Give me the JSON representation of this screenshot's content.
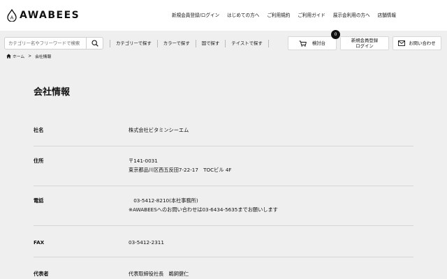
{
  "header": {
    "logo_text": "AWABEES",
    "nav": [
      "新規会員登録/ログイン",
      "はじめての方へ",
      "ご利用規約",
      "ご利用ガイド",
      "展示会利用の方へ",
      "店舗情報"
    ]
  },
  "search": {
    "placeholder": "カテゴリー名やフリーワードで検索"
  },
  "filters": [
    "カテゴリーで探す",
    "カラーで探す",
    "国で探す",
    "テイストで探す"
  ],
  "actions": {
    "cart_label": "検討台",
    "cart_count": "0",
    "register_label_line1": "新規会員登録",
    "register_label_line2": "ログイン",
    "contact_label": "お問い合わせ"
  },
  "breadcrumb": {
    "home": "ホーム",
    "separator": ">",
    "current": "会社情報"
  },
  "page": {
    "title": "会社情報",
    "rows": [
      {
        "label": "社名",
        "lines": [
          "株式会社ビタミンシーエム"
        ]
      },
      {
        "label": "住所",
        "lines": [
          "〒141-0031",
          "東京都品川区西五反田7-22-17　TOCビル 4F"
        ]
      },
      {
        "label": "電話",
        "lines": [
          "　03-5412-8210(本社事務所)",
          "※AWABEESへのお問い合わせは03-6434-5635までお願いします"
        ]
      },
      {
        "label": "FAX",
        "lines": [
          "03-5412-2311"
        ]
      },
      {
        "label": "代表者",
        "lines": [
          "代表取締役社長　鵜飼健仁"
        ]
      }
    ]
  }
}
